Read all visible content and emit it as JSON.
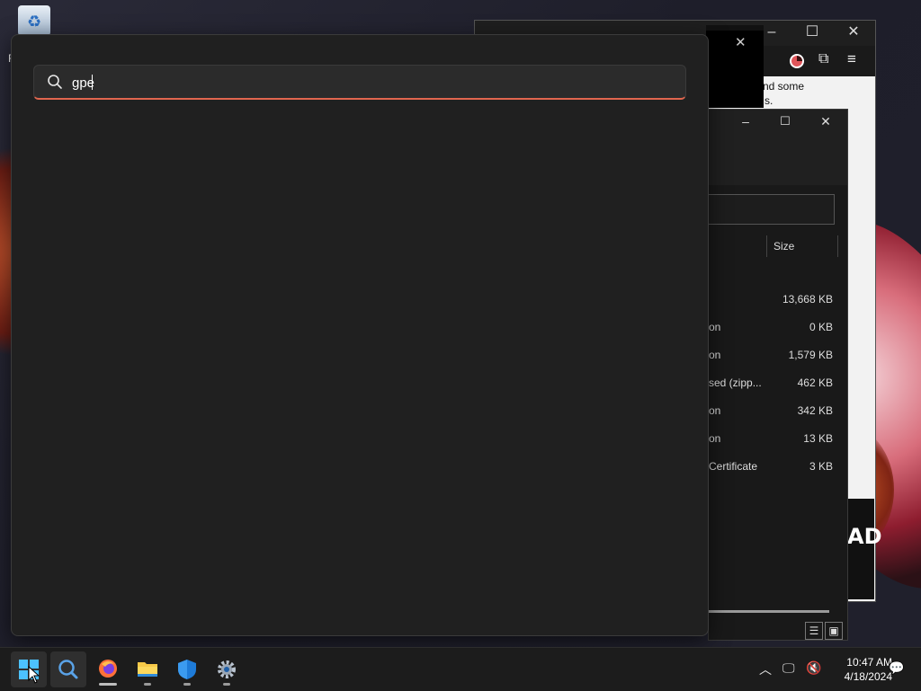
{
  "desktop": {
    "recycle_bin_label": "R",
    "browser_snippet_1": "nd some",
    "browser_snippet_2": "s.",
    "browser_banner_text": "AD"
  },
  "file_explorer": {
    "column_size": "Size",
    "rows": [
      {
        "type": "",
        "size": "13,668 KB"
      },
      {
        "type": "on",
        "size": "0 KB"
      },
      {
        "type": "on",
        "size": "1,579 KB"
      },
      {
        "type": "sed (zipp...",
        "size": "462 KB"
      },
      {
        "type": "on",
        "size": "342 KB"
      },
      {
        "type": "on",
        "size": "13 KB"
      },
      {
        "type": "Certificate",
        "size": "3 KB"
      }
    ]
  },
  "search_panel": {
    "query": "gpe"
  },
  "taskbar": {
    "time": "10:47 AM",
    "date": "4/18/2024",
    "accent_color": "#e0664e"
  }
}
